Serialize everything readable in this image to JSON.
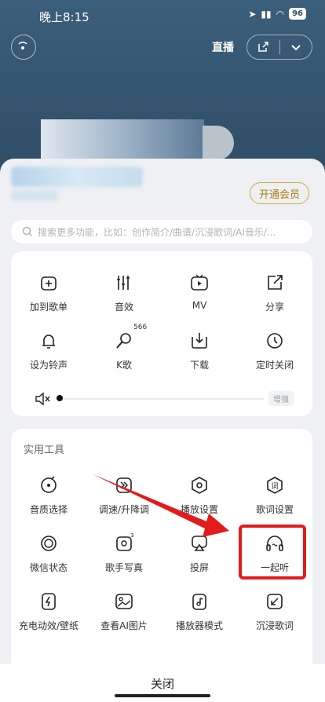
{
  "status": {
    "time": "晚上8:15",
    "battery": "96"
  },
  "top": {
    "live_label": "直播"
  },
  "vip_label": "开通会员",
  "search": {
    "placeholder": "搜索更多功能，比如：创作简介/曲谱/沉浸歌词/AI音乐/..."
  },
  "actions": [
    {
      "label": "加到歌单",
      "icon": "add-to-playlist-icon"
    },
    {
      "label": "音效",
      "icon": "equalizer-icon"
    },
    {
      "label": "MV",
      "icon": "mv-icon"
    },
    {
      "label": "分享",
      "icon": "share-icon"
    },
    {
      "label": "设为铃声",
      "icon": "bell-icon"
    },
    {
      "label": "K歌",
      "icon": "karaoke-icon",
      "badge": "566"
    },
    {
      "label": "下载",
      "icon": "download-icon"
    },
    {
      "label": "定时关闭",
      "icon": "clock-icon"
    }
  ],
  "volume": {
    "level": 0.0,
    "boost_label": "增强"
  },
  "tools": {
    "title": "实用工具",
    "items": [
      {
        "label": "音质选择",
        "icon": "quality-icon"
      },
      {
        "label": "调速/升降调",
        "icon": "speed-icon"
      },
      {
        "label": "播放设置",
        "icon": "play-settings-icon"
      },
      {
        "label": "歌词设置",
        "icon": "lyrics-settings-icon"
      },
      {
        "label": "微信状态",
        "icon": "wechat-status-icon"
      },
      {
        "label": "歌手写真",
        "icon": "singer-photo-icon"
      },
      {
        "label": "投屏",
        "icon": "cast-screen-icon"
      },
      {
        "label": "一起听",
        "icon": "listen-together-icon"
      },
      {
        "label": "充电动效/壁纸",
        "icon": "charging-icon"
      },
      {
        "label": "查看AI图片",
        "icon": "ai-image-icon"
      },
      {
        "label": "播放器模式",
        "icon": "player-mode-icon"
      },
      {
        "label": "沉浸歌词",
        "icon": "immersive-lyrics-icon"
      }
    ]
  },
  "close_label": "关闭"
}
